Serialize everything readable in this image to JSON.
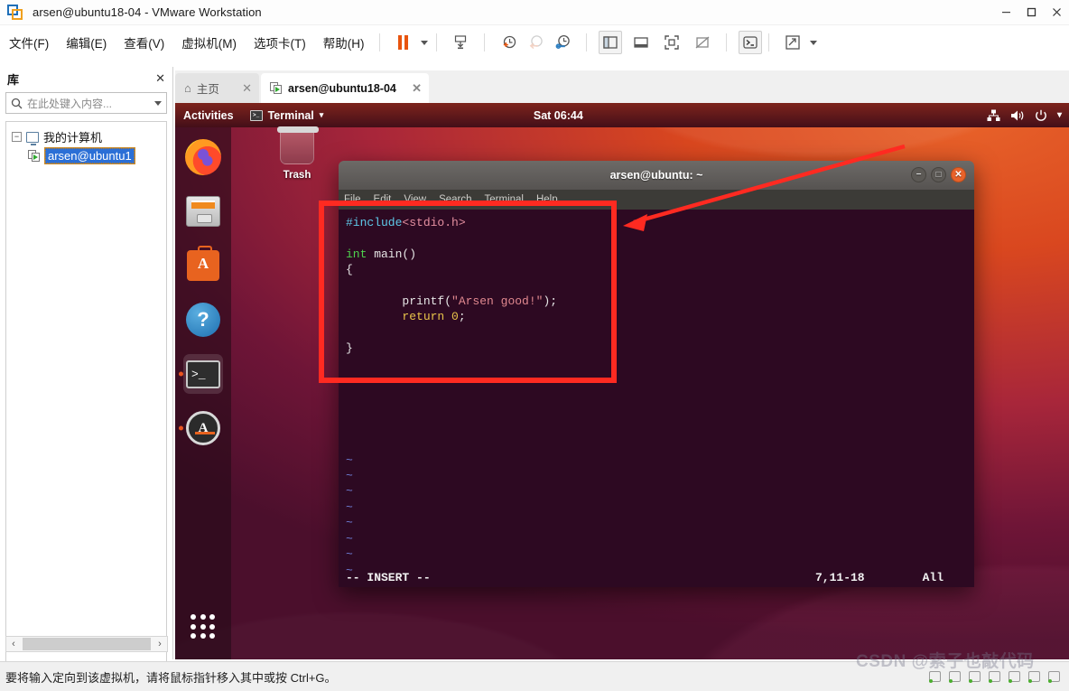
{
  "window": {
    "title": "arsen@ubuntu18-04 - VMware Workstation",
    "logo_icon": "vmware-logo-icon",
    "minimize_label": "—",
    "maximize_label": "☐",
    "close_label": "✕"
  },
  "menubar": {
    "items": [
      {
        "label": "文件(F)",
        "name": "menu-file"
      },
      {
        "label": "编辑(E)",
        "name": "menu-edit"
      },
      {
        "label": "查看(V)",
        "name": "menu-view"
      },
      {
        "label": "虚拟机(M)",
        "name": "menu-vm"
      },
      {
        "label": "选项卡(T)",
        "name": "menu-tabs"
      },
      {
        "label": "帮助(H)",
        "name": "menu-help"
      }
    ],
    "toolbar": [
      {
        "name": "suspend-button",
        "icon": "pause-icon"
      },
      {
        "name": "suspend-dropdown",
        "icon": "chevron-down-icon"
      },
      {
        "name": "snapshot-button",
        "icon": "snapshot-icon"
      },
      {
        "name": "take-snapshot-button",
        "icon": "clock-plus-icon"
      },
      {
        "name": "revert-snapshot-button",
        "icon": "clock-back-icon"
      },
      {
        "name": "manage-snapshots-button",
        "icon": "clock-wrench-icon"
      },
      {
        "name": "show-library-button",
        "icon": "sidebar-panel-icon"
      },
      {
        "name": "show-thumbnail-bar-button",
        "icon": "bottom-panel-icon"
      },
      {
        "name": "fullscreen-button",
        "icon": "fullscreen-icon"
      },
      {
        "name": "unity-mode-button",
        "icon": "unity-mode-icon"
      },
      {
        "name": "console-button",
        "icon": "console-icon"
      },
      {
        "name": "stretch-button",
        "icon": "expand-arrows-icon"
      },
      {
        "name": "stretch-dropdown",
        "icon": "chevron-down-icon"
      }
    ]
  },
  "library": {
    "title": "库",
    "close_label": "✕",
    "search_placeholder": "在此处键入内容...",
    "search_value": "",
    "search_icon": "search-icon",
    "dropdown_icon": "chevron-down-icon",
    "tree": {
      "root_label": "我的计算机",
      "root_expander": "−",
      "root_icon": "computer-icon",
      "child_label": "arsen@ubuntu1",
      "child_icon": "vm-running-icon"
    },
    "scroll_left": "‹",
    "scroll_right": "›"
  },
  "tabs": [
    {
      "label": "主页",
      "icon": "home-icon",
      "close": "✕",
      "active": false,
      "name": "tab-home"
    },
    {
      "label": "arsen@ubuntu18-04",
      "icon": "vm-running-icon",
      "close": "✕",
      "active": true,
      "name": "tab-vm-arsen"
    }
  ],
  "guest": {
    "topbar": {
      "activities": "Activities",
      "app_menu": "Terminal",
      "app_menu_caret": "▾",
      "app_icon": "terminal-icon",
      "clock": "Sat 06:44",
      "network_icon": "network-icon",
      "volume_icon": "volume-icon",
      "power_icon": "power-icon",
      "tray_caret": "▾"
    },
    "dock": [
      {
        "name": "dock-item-firefox",
        "icon": "firefox-icon",
        "running": false,
        "active": false
      },
      {
        "name": "dock-item-files",
        "icon": "files-icon",
        "running": false,
        "active": false
      },
      {
        "name": "dock-item-ubuntu-software",
        "icon": "ubuntu-software-icon",
        "running": false,
        "active": false
      },
      {
        "name": "dock-item-help",
        "icon": "help-icon",
        "running": false,
        "active": false
      },
      {
        "name": "dock-item-terminal",
        "icon": "terminal-icon",
        "running": true,
        "active": true
      },
      {
        "name": "dock-item-software-updater",
        "icon": "software-updater-icon",
        "running": true,
        "active": false
      }
    ],
    "show_apps_icon": "grid-dots-icon",
    "desktop": {
      "trash_label": "Trash",
      "trash_icon": "trash-icon"
    }
  },
  "terminal": {
    "title": "arsen@ubuntu: ~",
    "minimize": "−",
    "maximize": "□",
    "close": "✕",
    "menu": [
      "File",
      "Edit",
      "View",
      "Search",
      "Terminal",
      "Help"
    ],
    "code": {
      "line1_include": "#include",
      "line1_header": "<stdio.h>",
      "line3_kw": "int",
      "line3_rest": " main()",
      "line4": "{",
      "line6_call": "        printf(",
      "line6_str": "\"Arsen good!\"",
      "line6_tail": ");",
      "line7_kw": "        return",
      "line7_num": " 0",
      "line7_tail": ";",
      "line9": "}"
    },
    "tildes": [
      "~",
      "~",
      "~",
      "~",
      "~",
      "~",
      "~",
      "~"
    ],
    "status_mode": "-- INSERT --",
    "status_position": "7,11-18",
    "status_scroll": "All"
  },
  "annotation": {
    "box_color": "#ff2a21",
    "arrow_color": "#ff2a21",
    "arrow_icon": "arrow-pointer-icon"
  },
  "statusbar": {
    "hint": "要将输入定向到该虚拟机，请将鼠标指针移入其中或按 Ctrl+G。",
    "devices": [
      "device-1",
      "device-2",
      "device-3",
      "device-4",
      "device-5",
      "device-6",
      "device-7"
    ]
  },
  "watermark": {
    "text": "CSDN @索子也敲代码"
  }
}
